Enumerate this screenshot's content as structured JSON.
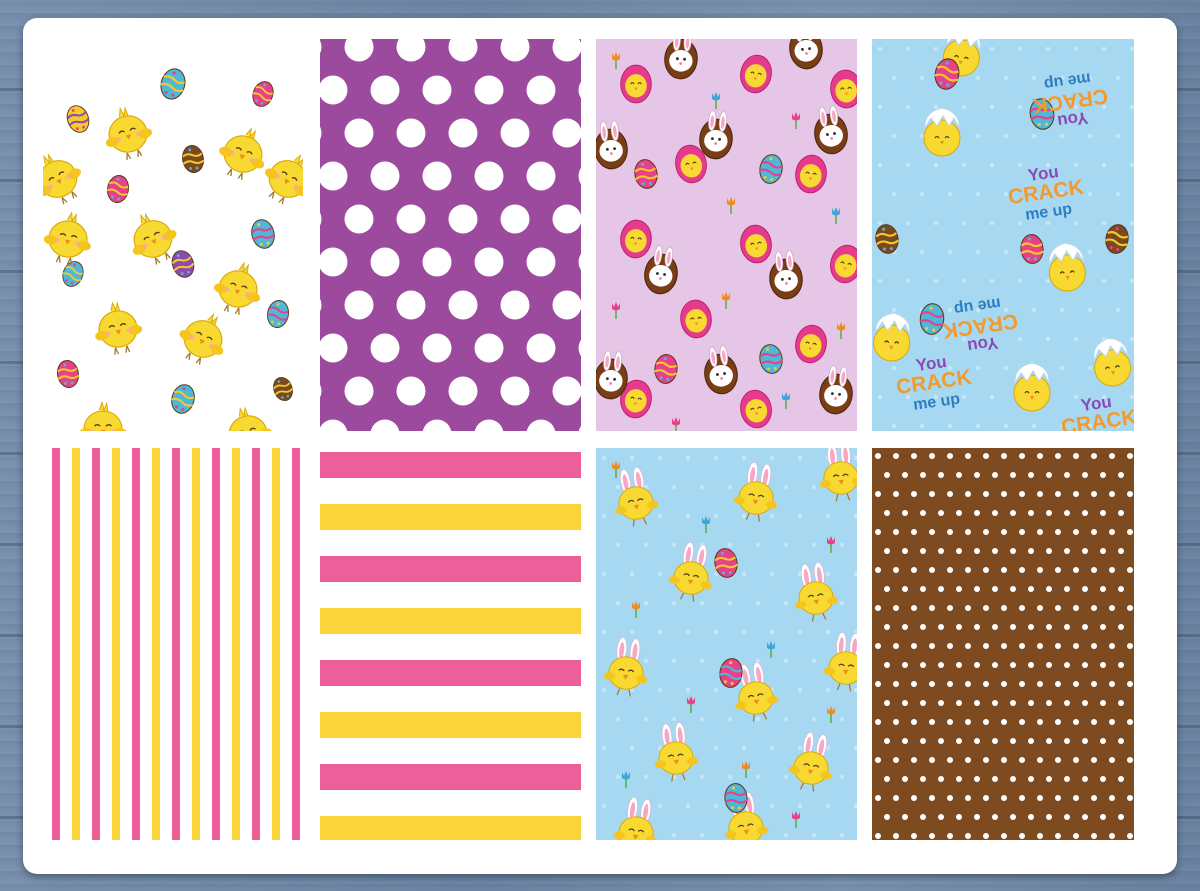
{
  "sheet": {
    "background": "#ffffff"
  },
  "colors": {
    "wood": "#6f87a6",
    "purple": "#9b4a9e",
    "pink": "#ec5f9a",
    "yellow": "#f9d43a",
    "brown": "#7d4b1f",
    "sky": "#a7d8f2",
    "lavender": "#e6c6e6",
    "chick": "#f8d932"
  },
  "papers": [
    {
      "id": "chicks-eggs-white",
      "pattern": "chicks and decorated eggs on white",
      "background": "#ffffff"
    },
    {
      "id": "purple-polka-dot",
      "pattern": "white polka dots on purple",
      "background": "#9b4a9e"
    },
    {
      "id": "bunnies-eggs-lavender",
      "pattern": "bunny eggs, chicks and tulips on lavender",
      "background": "#e6c6e6"
    },
    {
      "id": "you-crack-me-up-blue",
      "pattern": "hatching chicks and text on light blue",
      "background": "#a7d8f2"
    },
    {
      "id": "pink-yellow-vertical-stripes",
      "pattern": "pink and yellow vertical stripes",
      "background": "#ffffff"
    },
    {
      "id": "pink-yellow-horizontal-stripes",
      "pattern": "pink and yellow horizontal stripes",
      "background": "#ffffff"
    },
    {
      "id": "bunny-chicks-blue",
      "pattern": "chicks with bunny ears on light blue",
      "background": "#a7d8f2"
    },
    {
      "id": "brown-polka-dot",
      "pattern": "small white dots on brown",
      "background": "#7d4b1f"
    }
  ],
  "texts": {
    "crack_line1": "You",
    "crack_line2": "CRACK",
    "crack_line3": "me up"
  }
}
